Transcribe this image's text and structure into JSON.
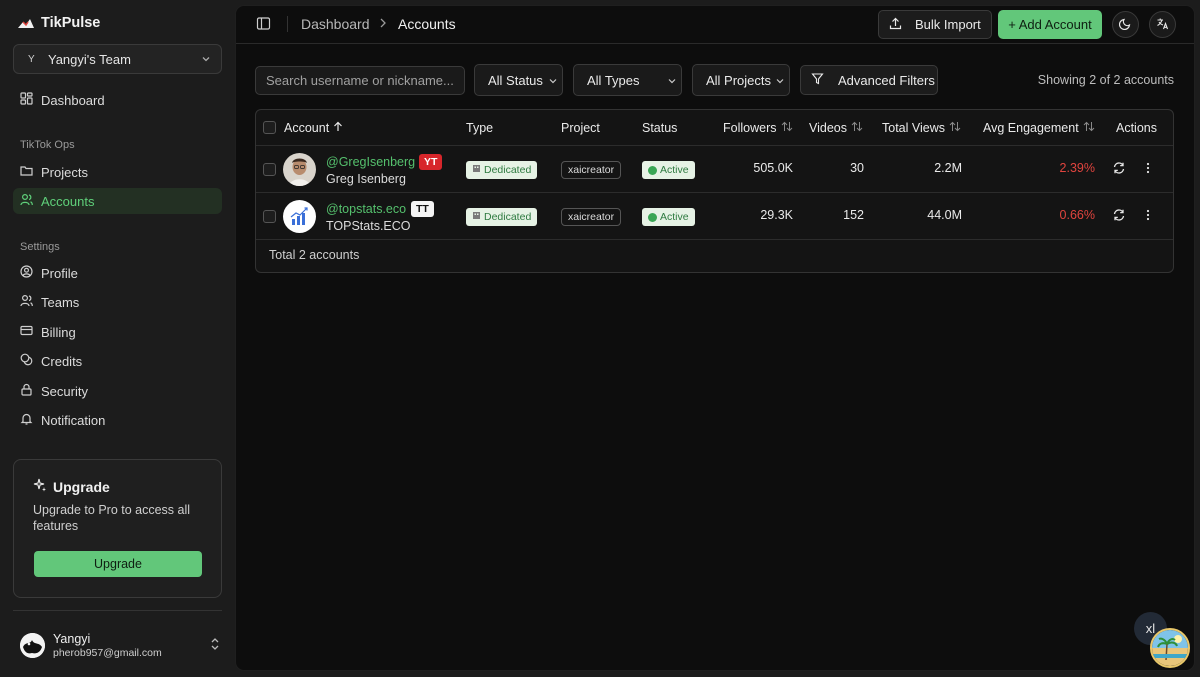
{
  "app": {
    "name": "TikPulse"
  },
  "team": {
    "initial": "Y",
    "name": "Yangyi's Team"
  },
  "sidebar": {
    "dashboard": "Dashboard",
    "section_ops": "TikTok Ops",
    "projects": "Projects",
    "accounts": "Accounts",
    "section_settings": "Settings",
    "profile": "Profile",
    "teams": "Teams",
    "billing": "Billing",
    "credits": "Credits",
    "security": "Security",
    "notification": "Notification"
  },
  "upgrade": {
    "title": "Upgrade",
    "text": "Upgrade to Pro to access all features",
    "button": "Upgrade"
  },
  "user": {
    "name": "Yangyi",
    "email": "pherob957@gmail.com"
  },
  "breadcrumb": {
    "parent": "Dashboard",
    "current": "Accounts"
  },
  "toolbar": {
    "bulk_import": "Bulk Import",
    "add_account": "+ Add Account"
  },
  "filters": {
    "search_placeholder": "Search username or nickname...",
    "status": "All Status",
    "types": "All Types",
    "projects": "All Projects",
    "advanced": "Advanced Filters",
    "showing": "Showing 2 of 2 accounts"
  },
  "table": {
    "columns": {
      "account": "Account",
      "type": "Type",
      "project": "Project",
      "status": "Status",
      "followers": "Followers",
      "videos": "Videos",
      "total_views": "Total Views",
      "avg_engagement": "Avg Engagement",
      "actions": "Actions"
    },
    "rows": [
      {
        "handle": "@GregIsenberg",
        "platform": "YT",
        "nickname": "Greg Isenberg",
        "type": "Dedicated",
        "project": "xaicreator",
        "status": "Active",
        "followers": "505.0K",
        "videos": "30",
        "total_views": "2.2M",
        "avg_engagement": "2.39%"
      },
      {
        "handle": "@topstats.eco",
        "platform": "TT",
        "nickname": "TOPStats.ECO",
        "type": "Dedicated",
        "project": "xaicreator",
        "status": "Active",
        "followers": "29.3K",
        "videos": "152",
        "total_views": "44.0M",
        "avg_engagement": "0.66%"
      }
    ],
    "footer": "Total 2 accounts"
  },
  "floating": {
    "label": "xl"
  },
  "colors": {
    "accent": "#62c77a",
    "danger": "#e0443e",
    "youtube": "#d7262b"
  }
}
